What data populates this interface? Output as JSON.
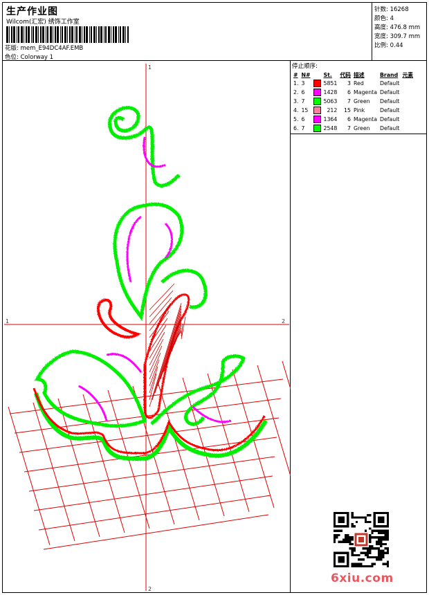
{
  "header": {
    "title": "生产作业图",
    "company": "Wilcom(汇宏) 绣饰工作室",
    "design_label": "花版:",
    "design_file": "mem_E94DC4AF.EMB",
    "colorway_label": "色位:",
    "colorway": "Colorway 1"
  },
  "stats": {
    "stitches_label": "针数:",
    "stitches": "16268",
    "colors_label": "颜色:",
    "colors": "4",
    "height_label": "高度:",
    "height": "476.8 mm",
    "width_label": "宽度:",
    "width": "309.7 mm",
    "scale_label": "比例:",
    "scale": "0.44"
  },
  "stop_sequence": {
    "title": "停止顺序:",
    "headers": [
      "#",
      "N#",
      "St.",
      "代码",
      "描述",
      "Brand",
      "元素"
    ],
    "rows": [
      {
        "idx": "1.",
        "n": "3",
        "color": "#ff0000",
        "st": "5851",
        "code": "3",
        "desc": "Red",
        "brand": "Default"
      },
      {
        "idx": "2.",
        "n": "6",
        "color": "#ff00ff",
        "st": "1428",
        "code": "6",
        "desc": "Magenta",
        "brand": "Default"
      },
      {
        "idx": "3.",
        "n": "7",
        "color": "#00ff00",
        "st": "5063",
        "code": "7",
        "desc": "Green",
        "brand": "Default"
      },
      {
        "idx": "4.",
        "n": "15",
        "color": "#ff80a0",
        "st": "212",
        "code": "15",
        "desc": "Pink",
        "brand": "Default"
      },
      {
        "idx": "5.",
        "n": "6",
        "color": "#ff00ff",
        "st": "1364",
        "code": "6",
        "desc": "Magenta",
        "brand": "Default"
      },
      {
        "idx": "6.",
        "n": "7",
        "color": "#00ff00",
        "st": "2548",
        "code": "7",
        "desc": "Green",
        "brand": "Default"
      }
    ]
  },
  "axes": {
    "top": "1",
    "bottom": "2",
    "left": "1",
    "right": "2"
  },
  "watermark": "6xiu.com"
}
